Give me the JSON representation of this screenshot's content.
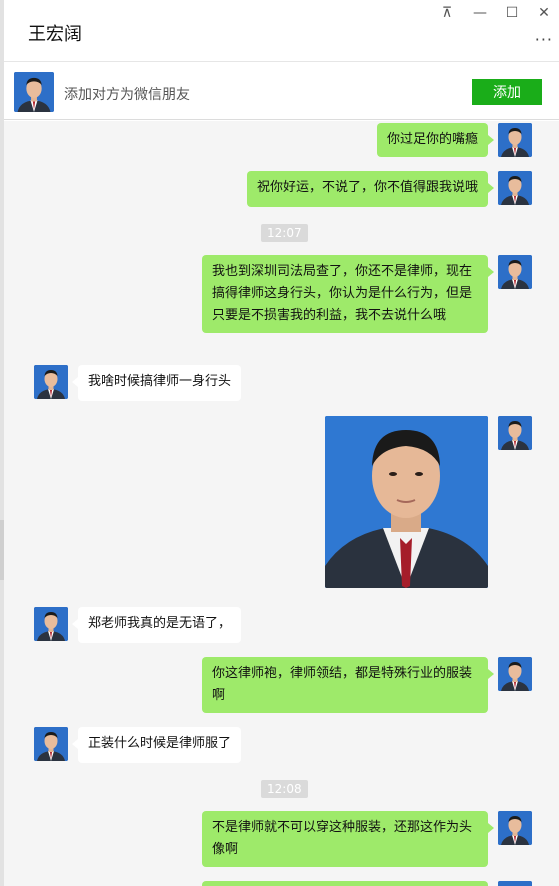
{
  "window": {
    "title": "王宏阔",
    "pin_icon": "pin-icon",
    "minimize_icon": "minimize-icon",
    "maximize_icon": "maximize-icon",
    "close_icon": "close-icon",
    "more_icon": "more-icon",
    "pin_glyph": "⊼",
    "minimize_glyph": "—",
    "maximize_glyph": "☐",
    "close_glyph": "✕",
    "more_glyph": "···"
  },
  "add_friend": {
    "text": "添加对方为微信朋友",
    "button_label": "添加"
  },
  "colors": {
    "outgoing_bubble": "#9eea6a",
    "incoming_bubble": "#ffffff",
    "add_button": "#1aad19",
    "chat_background": "#f5f5f5"
  },
  "messages": [
    {
      "side": "out",
      "text": "你过足你的嘴瘾"
    },
    {
      "side": "out",
      "text": "祝你好运，不说了，你不值得跟我说哦"
    },
    {
      "time": "12:07"
    },
    {
      "side": "out",
      "text": "我也到深圳司法局查了，你还不是律师，现在搞得律师这身行头，你认为是什么行为，但是只要是不损害我的利益，我不去说什么哦"
    },
    {
      "side": "in",
      "text": "我啥时候搞律师一身行头"
    },
    {
      "side": "out",
      "image": "portrait-photo"
    },
    {
      "side": "in",
      "text": "郑老师我真的是无语了，"
    },
    {
      "side": "out",
      "text": "你这律师袍，律师领结，都是特殊行业的服装啊"
    },
    {
      "side": "in",
      "text": "正装什么时候是律师服了"
    },
    {
      "time": "12:08"
    },
    {
      "side": "out",
      "text": "不是律师就不可以穿这种服装，还那这作为头像啊"
    }
  ]
}
